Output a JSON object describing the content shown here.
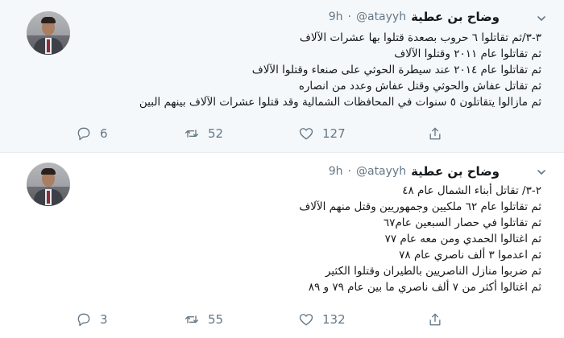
{
  "tweets": [
    {
      "author_name": "وضاح بن عطية",
      "handle": "@atayyh",
      "separator": "·",
      "time": "9h",
      "lines": [
        "٣-٣/ثم تقاتلوا ٦ حروب بصعدة قتلوا بها عشرات الآلاف",
        "ثم تقاتلوا عام ٢٠١١ وقتلوا الآلاف",
        "ثم تقاتلوا عام ٢٠١٤ عند سيطرة الحوثي على صنعاء وقتلوا الآلاف",
        "ثم تقاتل عفاش والحوثي وقتل عفاش وعدد من انصاره",
        "ثم مازالوا يتقاتلون ٥ سنوات في المحافظات الشمالية وقد قتلوا عشرات الآلاف بينهم البين"
      ],
      "replies": "6",
      "retweets": "52",
      "likes": "127"
    },
    {
      "author_name": "وضاح بن عطية",
      "handle": "@atayyh",
      "separator": "·",
      "time": "9h",
      "lines": [
        "٢-٣/ تقاتل أبناء الشمال عام ٤٨",
        "ثم تقاتلوا عام ٦٢ ملكيين وجمهوريين وقتل منهم الآلاف",
        "ثم تقاتلوا في حصار السبعين عام٦٧",
        "ثم اغتالوا الحمدي ومن معه عام ٧٧",
        "ثم اعدموا ٣ ألف ناصري عام ٧٨",
        "ثم ضربوا منازل الناصريين بالطيران وقتلوا الكثير",
        "ثم اغتالوا أكثر من ٧ ألف ناصري ما بين عام ٧٩ و ٨٩"
      ],
      "replies": "3",
      "retweets": "55",
      "likes": "132"
    }
  ],
  "icons": {
    "reply": "reply-icon",
    "retweet": "retweet-icon",
    "like": "heart-icon",
    "share": "share-icon",
    "more": "chevron-down-icon"
  },
  "colors": {
    "highlight_bg": "#f5f8fa",
    "meta_text": "#657786",
    "body_text": "#14171a"
  }
}
